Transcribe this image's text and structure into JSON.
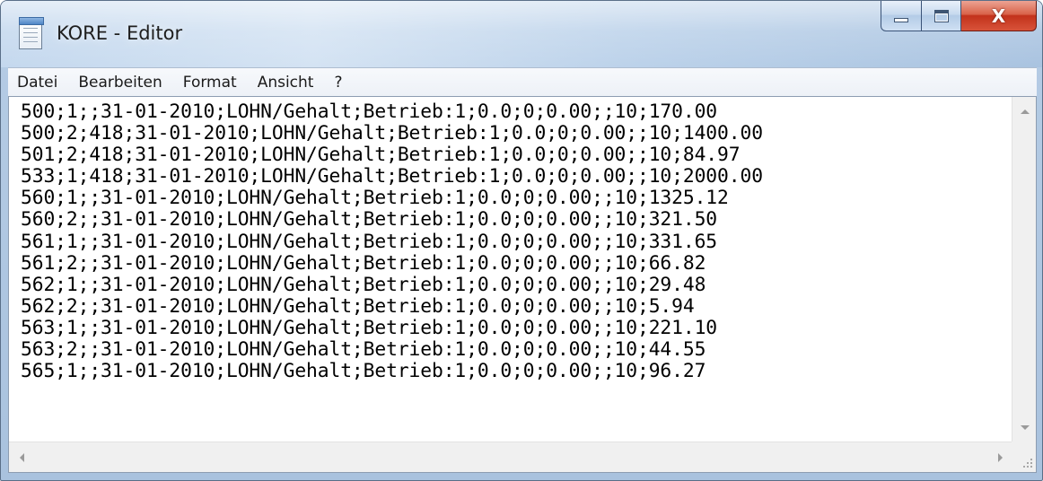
{
  "window": {
    "title": "KORE - Editor",
    "app_icon": "notepad-icon",
    "controls": {
      "minimize_icon": "minimize-icon",
      "maximize_icon": "maximize-icon",
      "close_icon": "close-icon",
      "close_glyph": "X"
    }
  },
  "menu": {
    "items": [
      {
        "label": "Datei"
      },
      {
        "label": "Bearbeiten"
      },
      {
        "label": "Format"
      },
      {
        "label": "Ansicht"
      },
      {
        "label": "?"
      }
    ]
  },
  "document": {
    "lines": [
      "500;1;;31-01-2010;LOHN/Gehalt;Betrieb:1;0.0;0;0.00;;10;170.00",
      "500;2;418;31-01-2010;LOHN/Gehalt;Betrieb:1;0.0;0;0.00;;10;1400.00",
      "501;2;418;31-01-2010;LOHN/Gehalt;Betrieb:1;0.0;0;0.00;;10;84.97",
      "533;1;418;31-01-2010;LOHN/Gehalt;Betrieb:1;0.0;0;0.00;;10;2000.00",
      "560;1;;31-01-2010;LOHN/Gehalt;Betrieb:1;0.0;0;0.00;;10;1325.12",
      "560;2;;31-01-2010;LOHN/Gehalt;Betrieb:1;0.0;0;0.00;;10;321.50",
      "561;1;;31-01-2010;LOHN/Gehalt;Betrieb:1;0.0;0;0.00;;10;331.65",
      "561;2;;31-01-2010;LOHN/Gehalt;Betrieb:1;0.0;0;0.00;;10;66.82",
      "562;1;;31-01-2010;LOHN/Gehalt;Betrieb:1;0.0;0;0.00;;10;29.48",
      "562;2;;31-01-2010;LOHN/Gehalt;Betrieb:1;0.0;0;0.00;;10;5.94",
      "563;1;;31-01-2010;LOHN/Gehalt;Betrieb:1;0.0;0;0.00;;10;221.10",
      "563;2;;31-01-2010;LOHN/Gehalt;Betrieb:1;0.0;0;0.00;;10;44.55",
      "565;1;;31-01-2010;LOHN/Gehalt;Betrieb:1;0.0;0;0.00;;10;96.27"
    ]
  },
  "colors": {
    "close_button": "#c2321b",
    "titlebar": "#c4d8ee",
    "text": "#000000"
  }
}
